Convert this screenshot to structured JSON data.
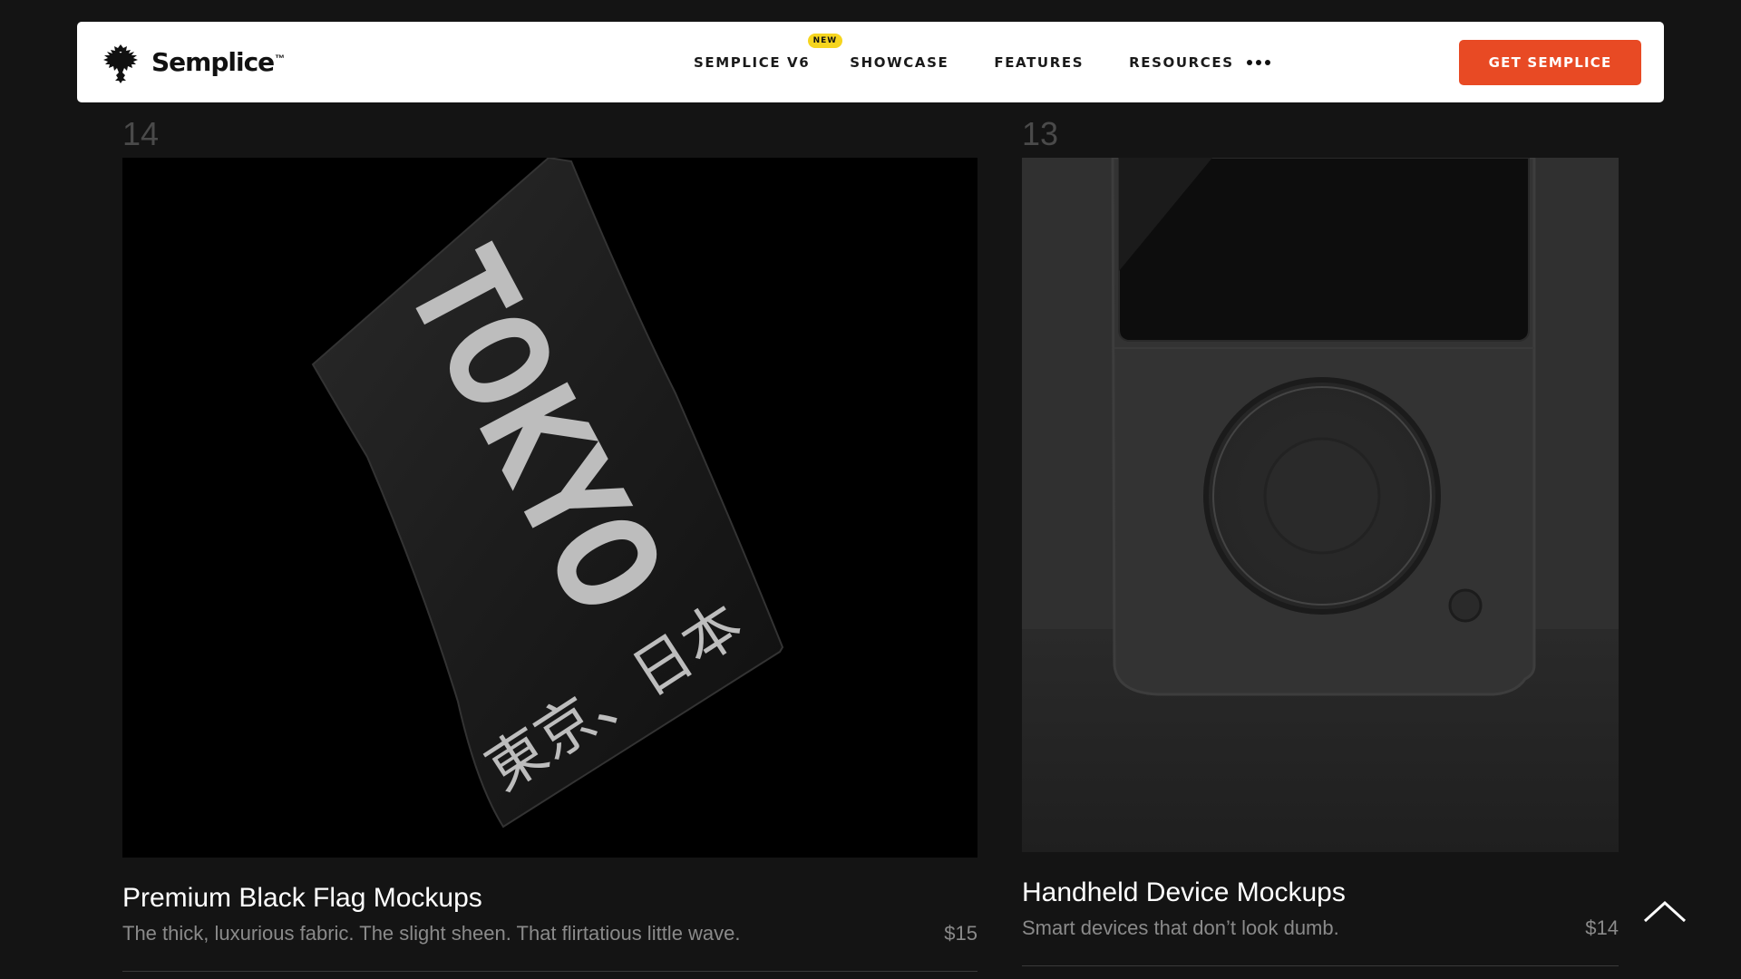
{
  "brand": {
    "name": "Semplice",
    "tm": "™"
  },
  "nav": {
    "items": [
      {
        "label": "SEMPLICE V6",
        "badge": "NEW"
      },
      {
        "label": "SHOWCASE"
      },
      {
        "label": "FEATURES"
      },
      {
        "label": "RESOURCES"
      }
    ],
    "more_icon": "more-dots-icon",
    "cta_label": "GET SEMPLICE"
  },
  "cards": [
    {
      "number": "14",
      "title": "Premium Black Flag Mockups",
      "description": "The thick, luxurious fabric. The slight sheen. That flirtatious little wave.",
      "price": "$15",
      "image_text": {
        "latin": "TOKYO",
        "japanese": "東京、日本"
      }
    },
    {
      "number": "13",
      "title": "Handheld  Device Mockups",
      "description": "Smart devices that don’t look dumb.",
      "price": "$14"
    }
  ],
  "colors": {
    "background": "#141414",
    "accent": "#e84a24",
    "badge": "#f6d51e",
    "muted_text": "#8a8a8a"
  },
  "scroll_top_icon": "chevron-up-icon"
}
